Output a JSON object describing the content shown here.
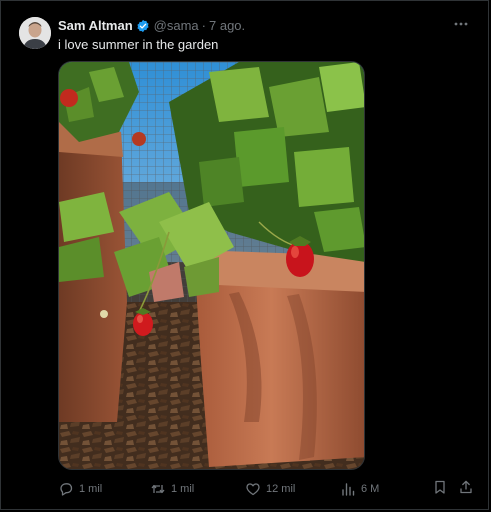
{
  "tweet": {
    "author_name": "Sam Altman",
    "handle": "@sama",
    "separator": "·",
    "timestamp": "7 ago.",
    "text": "i love summer in the garden",
    "verified_color": "#1d9bf0"
  },
  "icons": {
    "avatar": "avatar",
    "verified": "verified-badge-icon",
    "more": "more-options-icon",
    "reply": "reply-icon",
    "retweet": "retweet-icon",
    "like": "heart-icon",
    "views": "views-icon",
    "bookmark": "bookmark-icon",
    "share": "share-icon"
  },
  "actions": {
    "reply_count": "1 mil",
    "retweet_count": "1 mil",
    "like_count": "12 mil",
    "views_count": "6 M"
  },
  "colors": {
    "background": "#000000",
    "text_primary": "#e7e9ea",
    "text_secondary": "#71767b",
    "border": "#2f3336"
  }
}
